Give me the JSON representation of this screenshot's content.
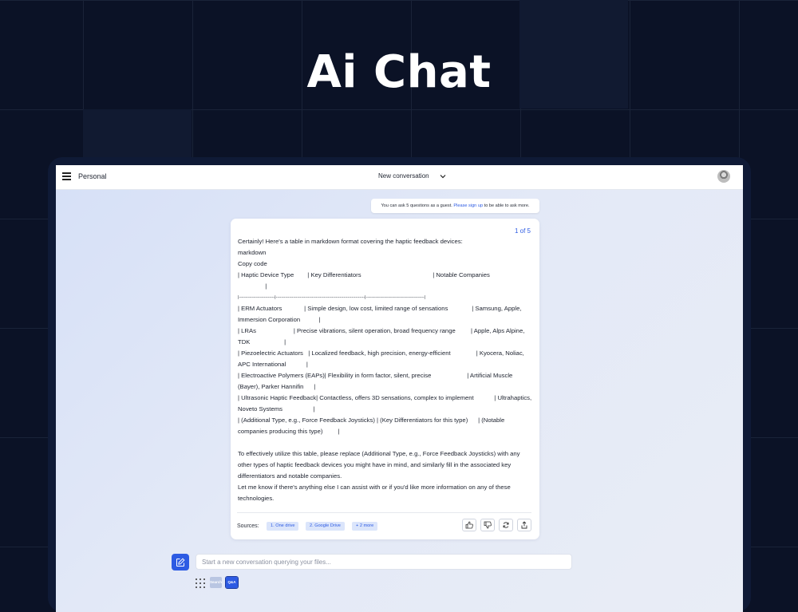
{
  "hero": {
    "title": "Ai Chat"
  },
  "topbar": {
    "workspace": "Personal",
    "conversation_title": "New conversation",
    "menu_icon": "hamburger-menu-icon",
    "dropdown_icon": "chevron-down-icon",
    "avatar_icon": "user-avatar"
  },
  "notice": {
    "prefix": "You can ask 5 questions as a guest.",
    "link": "Please sign up",
    "suffix": "to be able to ask more."
  },
  "answer": {
    "pager": "1 of 5",
    "lines": [
      "Certainly! Here's a table in markdown format covering the haptic feedback devices:",
      "markdown",
      "Copy code",
      "| Haptic Device Type        | Key Differentiators                                          | Notable Companies",
      "                |",
      "|---------------------------|-------------------------------------------------------------------|--------------------------------------------|",
      "| ERM Actuators             | Simple design, low cost, limited range of sensations              | Samsung, Apple, Immersion Corporation           |",
      "| LRAs                      | Precise vibrations, silent operation, broad frequency range         | Apple, Alps Alpine, TDK                    |",
      "| Piezoelectric Actuators   | Localized feedback, high precision, energy-efficient               | Kyocera, Noliac, APC International            |",
      "| Electroactive Polymers (EAPs)| Flexibility in form factor, silent, precise                     | Artificial Muscle (Bayer), Parker Hannifin      |",
      "| Ultrasonic Haptic Feedback| Contactless, offers 3D sensations, complex to implement            | Ultrahaptics, Noveto Systems                  |",
      "| (Additional Type, e.g., Force Feedback Joysticks) | (Key Differentiators for this type)      | (Notable companies producing this type)         |",
      "",
      "To effectively utilize this table, please replace (Additional Type, e.g., Force Feedback Joysticks) with any other types of haptic feedback devices you might have in mind, and similarly fill in the associated key differentiators and notable companies.",
      "Let me know if there's anything else I can assist with or if you'd like more information on any of these technologies."
    ],
    "sources_label": "Sources:",
    "sources": [
      "1. One drive",
      "2. Google Drive",
      "+ 2 more"
    ],
    "actions": [
      "thumbs-up-icon",
      "thumbs-down-icon",
      "refresh-icon",
      "share-icon"
    ]
  },
  "composer": {
    "placeholder": "Start a new conversation querying your files...",
    "compose_icon": "edit-icon",
    "apps_icon": "apps-grid-icon",
    "mode_search": "Search",
    "mode_qa": "Q&A"
  },
  "colors": {
    "accent": "#2d5be3",
    "background": "#0b1226",
    "chip_bg": "#dbe5fb"
  }
}
